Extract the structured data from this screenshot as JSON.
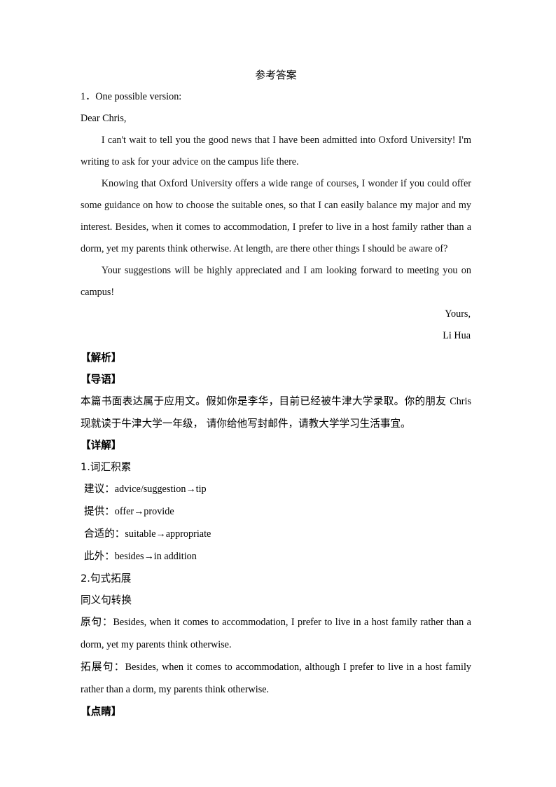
{
  "document": {
    "title": "参考答案",
    "answer": {
      "number_label": "1．One possible version:",
      "salutation": "Dear Chris,",
      "paragraphs": [
        "I can't wait to tell you the good news that I have been admitted into Oxford University! I'm writing to ask for your advice on the campus life there.",
        "Knowing that Oxford University offers a wide range of courses, I wonder if you could offer some guidance on how to choose the suitable ones, so that I can easily balance my major and my interest. Besides, when it comes to accommodation, I prefer to live in a host family rather than a dorm, yet my parents think otherwise. At length, are there other things I should be aware of?",
        "Your suggestions will be highly appreciated and I am looking forward to meeting you on campus!"
      ],
      "closing": "Yours,",
      "signature": "Li Hua"
    },
    "analysis": {
      "heading": "【解析】",
      "intro_heading": "【导语】",
      "intro_text_before": "本篇书面表达属于应用文。假如你是李华，目前已经被牛津大学录取。你的朋友 ",
      "intro_text_name": "Chris",
      "intro_text_after": " 现就读于牛津大学一年级， 请你给他写封邮件，请教大学学习生活事宜。",
      "detail_heading": "【详解】",
      "section1_title": "1.词汇积累",
      "vocabulary": [
        {
          "label": "建议：",
          "value": "advice/suggestion→tip"
        },
        {
          "label": "提供：",
          "value": "offer→provide"
        },
        {
          "label": "合适的：",
          "value": "suitable→appropriate"
        },
        {
          "label": "此外：",
          "value": "besides→in addition"
        }
      ],
      "section2_title": "2.句式拓展",
      "section2_subtitle": "同义句转换",
      "original": {
        "label": "原句：",
        "value": "Besides, when it comes to accommodation, I prefer to live in a host family rather than a dorm, yet my parents think otherwise."
      },
      "expanded": {
        "label": "拓展句：",
        "value": "Besides, when it comes to accommodation, although I prefer to live in a host family rather than a dorm, my parents think otherwise."
      },
      "highlight_heading": "【点睛】"
    }
  }
}
